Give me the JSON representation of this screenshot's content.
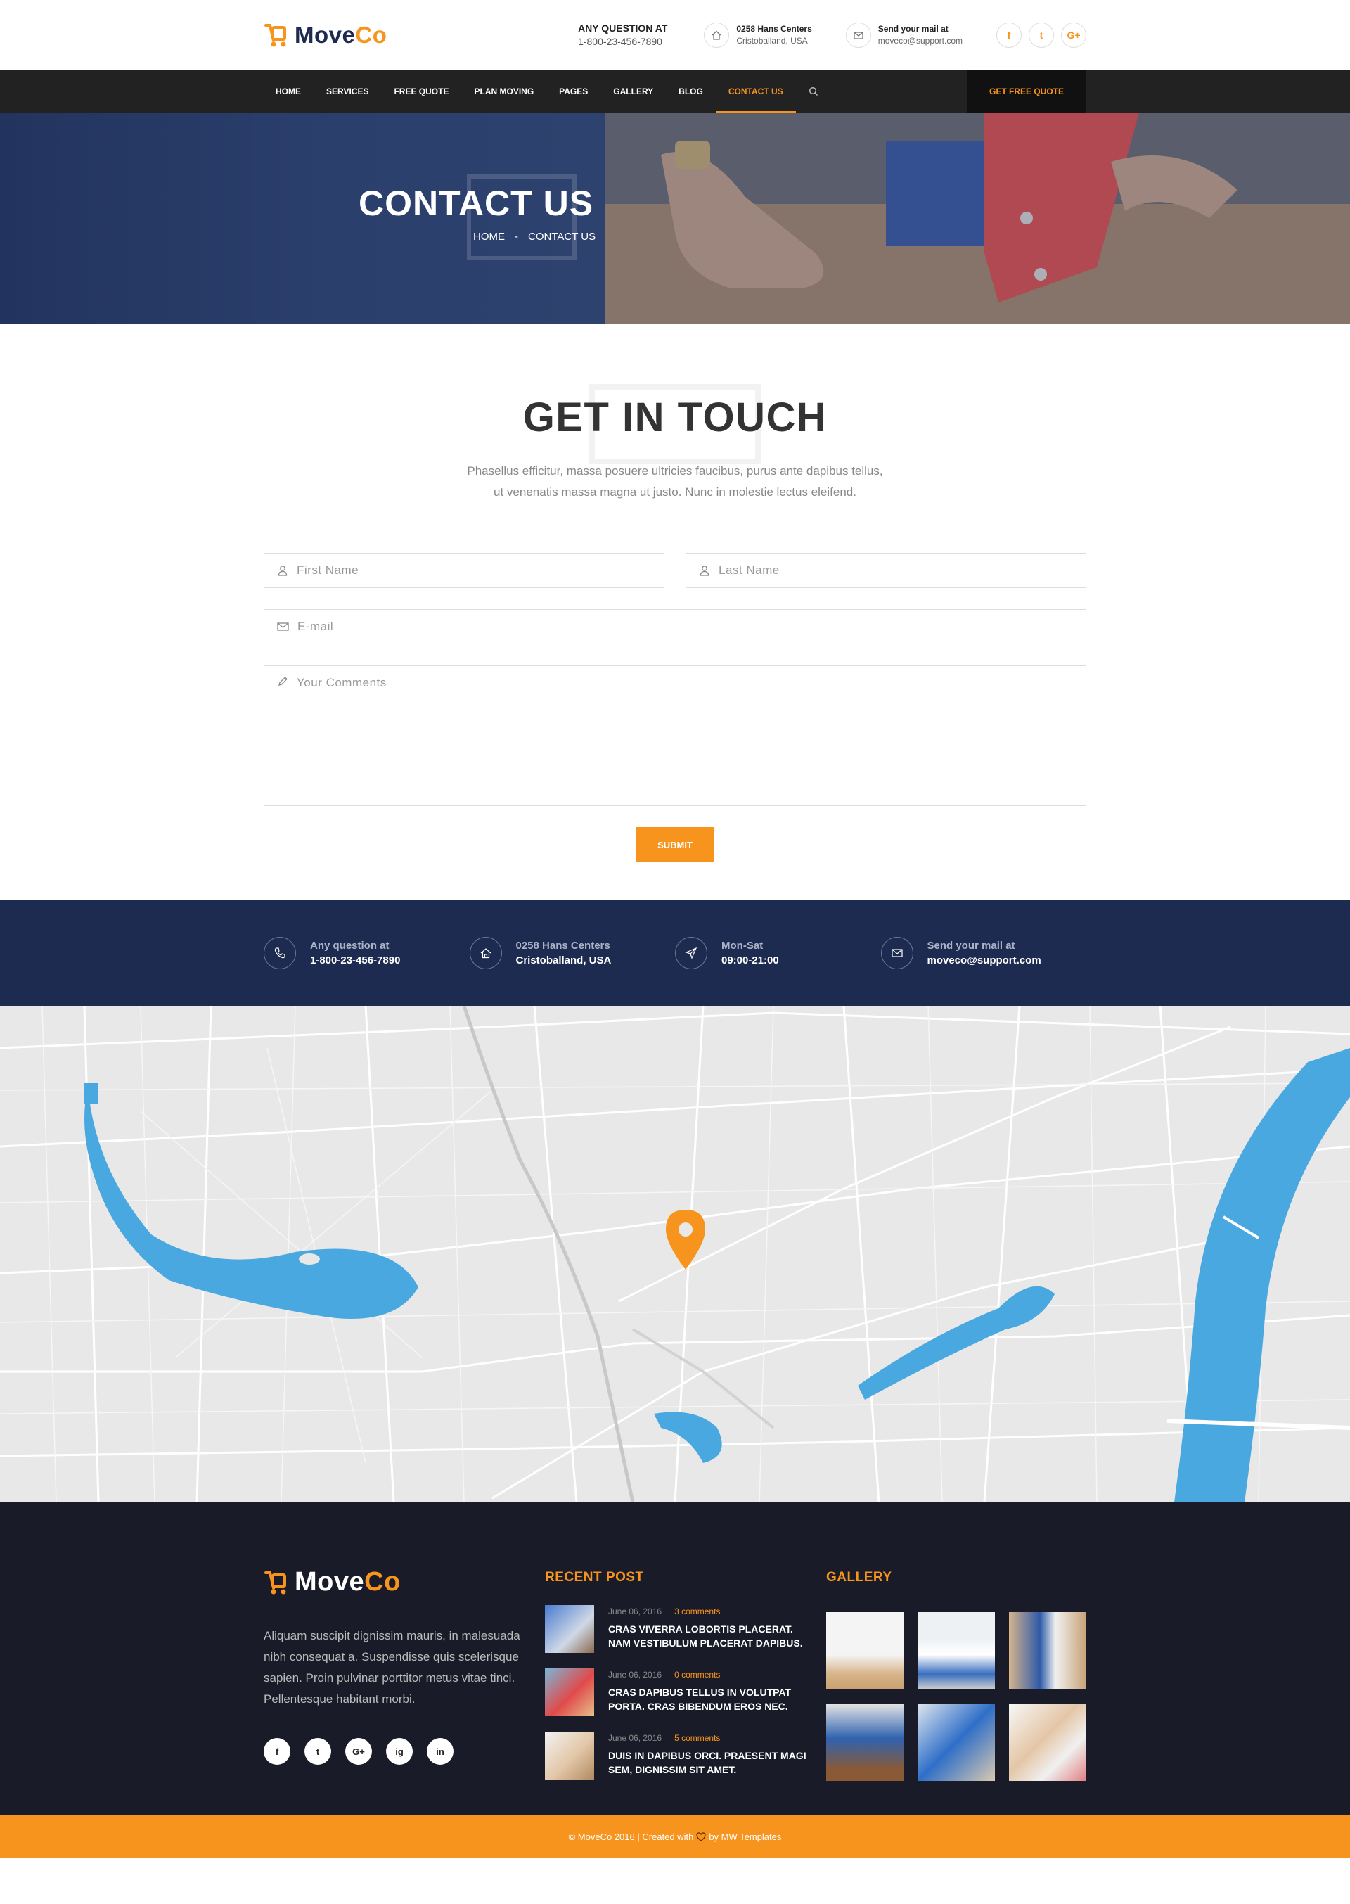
{
  "brand": {
    "name_part1": "Move",
    "name_part2": "Co"
  },
  "header": {
    "phone_label": "ANY QUESTION AT",
    "phone": "1-800-23-456-7890",
    "address_line1": "0258 Hans Centers",
    "address_line2": "Cristoballand, USA",
    "mail_label": "Send your mail at",
    "mail": "moveco@support.com",
    "socials": [
      "f",
      "t",
      "G+"
    ]
  },
  "nav": {
    "items": [
      "HOME",
      "SERVICES",
      "FREE QUOTE",
      "PLAN MOVING",
      "PAGES",
      "GALLERY",
      "BLOG",
      "CONTACT US"
    ],
    "active_index": 7,
    "quote_button": "GET FREE QUOTE"
  },
  "banner": {
    "title": "CONTACT US",
    "crumb_home": "HOME",
    "crumb_sep": "-",
    "crumb_current": "CONTACT US"
  },
  "contact": {
    "title": "GET IN TOUCH",
    "text_line1": "Phasellus efficitur, massa posuere ultricies faucibus, purus ante dapibus tellus,",
    "text_line2": "ut venenatis massa magna ut justo. Nunc in molestie lectus eleifend.",
    "first_name_placeholder": "First Name",
    "last_name_placeholder": "Last Name",
    "email_placeholder": "E-mail",
    "comments_placeholder": "Your Comments",
    "submit": "SUBMIT"
  },
  "info": [
    {
      "label": "Any question at",
      "value": "1-800-23-456-7890"
    },
    {
      "label": "0258 Hans Centers",
      "value": "Cristoballand, USA"
    },
    {
      "label": "Mon-Sat",
      "value": "09:00-21:00"
    },
    {
      "label": "Send your mail at",
      "value": "moveco@support.com"
    }
  ],
  "footer": {
    "about": "Aliquam suscipit dignissim mauris, in malesuada nibh consequat a. Suspendisse quis scelerisque sapien. Proin pulvinar porttitor metus vitae tinci. Pellentesque habitant morbi.",
    "socials": [
      "f",
      "t",
      "G+",
      "ig",
      "in"
    ],
    "recent_title": "RECENT POST",
    "posts": [
      {
        "date": "June 06, 2016",
        "comments": "3 comments",
        "title": "CRAS VIVERRA LOBORTIS PLACERAT. NAM VESTIBULUM PLACERAT DAPIBUS."
      },
      {
        "date": "June 06, 2016",
        "comments": "0 comments",
        "title": "CRAS DAPIBUS TELLUS IN VOLUTPAT PORTA. CRAS BIBENDUM EROS NEC."
      },
      {
        "date": "June 06, 2016",
        "comments": "5 comments",
        "title": "DUIS IN DAPIBUS ORCI. PRAESENT MAGI SEM, DIGNISSIM SIT AMET."
      }
    ],
    "gallery_title": "GALLERY",
    "copyright_prefix": "© MoveCo 2016 | Created with",
    "copyright_suffix": "by MW Templates"
  },
  "colors": {
    "accent": "#f7941e",
    "navy": "#1e2b50",
    "dark": "#222222",
    "footer": "#1a1b28",
    "water": "#4aa8e0"
  }
}
